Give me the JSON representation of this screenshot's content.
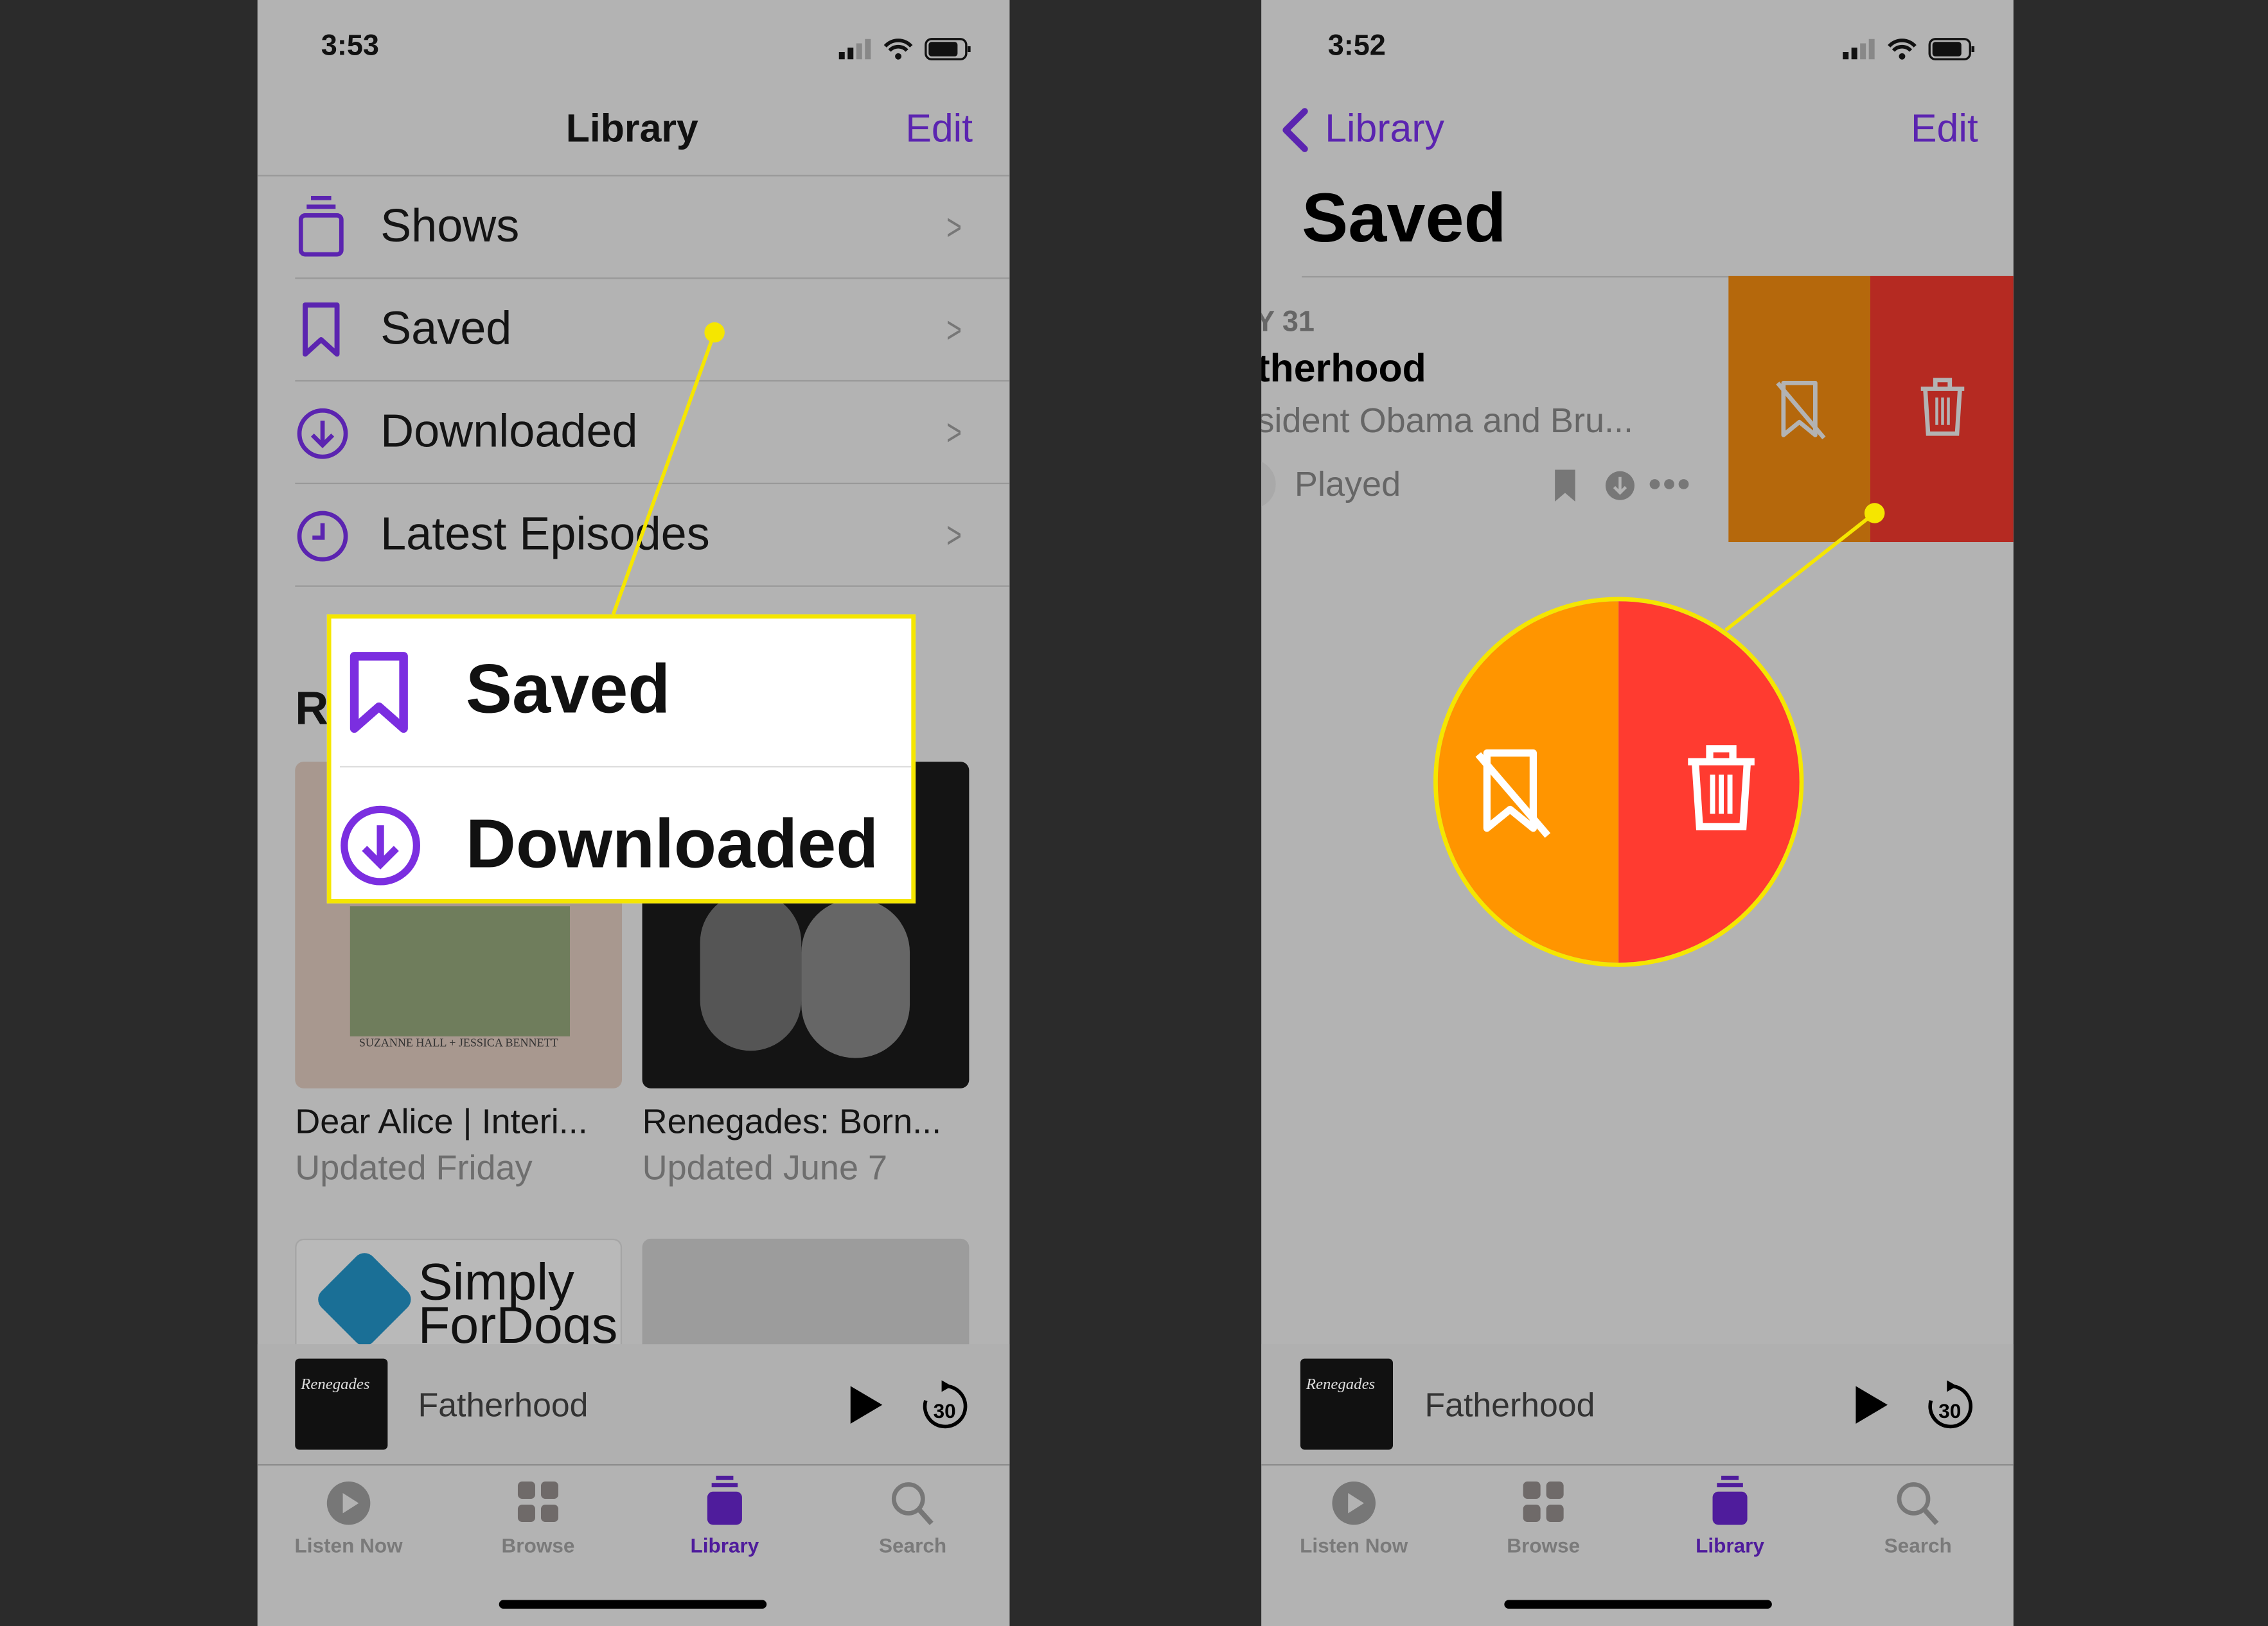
{
  "left": {
    "status": {
      "time": "3:53"
    },
    "nav": {
      "title": "Library",
      "edit": "Edit"
    },
    "rows": [
      {
        "label": "Shows",
        "icon": "stack-icon"
      },
      {
        "label": "Saved",
        "icon": "bookmark-icon"
      },
      {
        "label": "Downloaded",
        "icon": "download-circle-icon"
      },
      {
        "label": "Latest Episodes",
        "icon": "clock-icon"
      }
    ],
    "section_heading": "R",
    "cards": [
      {
        "title": "Dear Alice | Interi...",
        "subtitle": "Updated Friday",
        "art_text": "SUZANNE HALL + JESSICA BENNETT"
      },
      {
        "title": "Renegades: Born...",
        "subtitle": "Updated June 7"
      }
    ],
    "second_row_cards": [
      {
        "art_text": "Simply ForDogs"
      },
      {
        "art_text": ""
      }
    ],
    "callout": {
      "items": [
        "Saved",
        "Downloaded"
      ],
      "border_color": "#f5e600"
    }
  },
  "right": {
    "status": {
      "time": "3:52"
    },
    "nav": {
      "back": "Library",
      "edit": "Edit"
    },
    "large_title": "Saved",
    "episode": {
      "date": "Y 31",
      "title": "therhood",
      "description": "sident Obama and Bru...",
      "status": "Played"
    },
    "swipe_actions": [
      {
        "name": "unsave",
        "icon": "bookmark-slash-icon",
        "color": "#b5680c",
        "callout_color": "#ff9500"
      },
      {
        "name": "delete",
        "icon": "trash-icon",
        "color": "#b52a22",
        "callout_color": "#ff3b30"
      }
    ]
  },
  "mini_player": {
    "title": "Fatherhood",
    "art_text": "Renegades",
    "skip": "30"
  },
  "tabs": [
    {
      "label": "Listen Now",
      "icon": "play-circle-icon",
      "active": false
    },
    {
      "label": "Browse",
      "icon": "grid-icon",
      "active": false
    },
    {
      "label": "Library",
      "icon": "library-stack-icon",
      "active": true
    },
    {
      "label": "Search",
      "icon": "search-icon",
      "active": false
    }
  ],
  "colors": {
    "accent": "#5b24b0",
    "highlight": "#f5e600"
  }
}
